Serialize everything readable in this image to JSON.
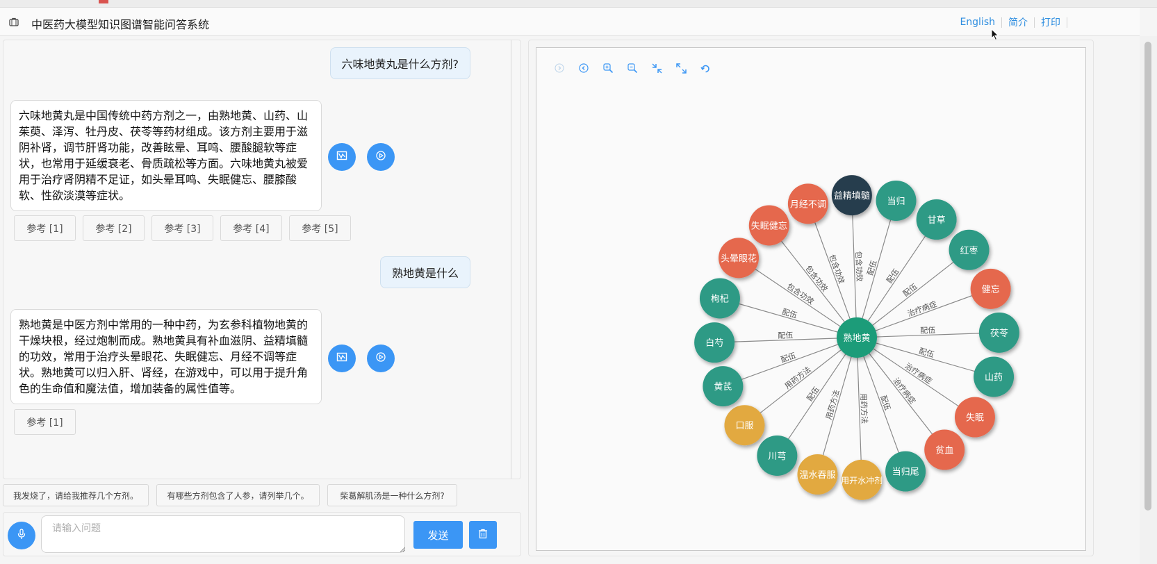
{
  "header": {
    "title": "中医药大模型知识图谱智能问答系统",
    "nav": [
      "English",
      "简介",
      "打印"
    ]
  },
  "chat": {
    "messages": [
      {
        "role": "user",
        "text": "六味地黄丸是什么方剂?"
      },
      {
        "role": "bot",
        "lines": [
          "六味地黄丸是中国传统中药方剂之一，由熟地黄、山药、山",
          "茱萸、泽泻、牡丹皮、茯苓等药材组成。该方剂主要用于滋",
          "阴补肾，调节肝肾功能，改善眩晕、耳鸣、腰酸腿软等症",
          "状，也常用于延缓衰老、骨质疏松等方面。六味地黄丸被爱",
          "用于治疗肾阴精不足证，如头晕耳鸣、失眠健忘、腰膝酸",
          "软、性欲淡漠等症状。"
        ],
        "refs": [
          "参考 [1]",
          "参考 [2]",
          "参考 [3]",
          "参考 [4]",
          "参考 [5]"
        ]
      },
      {
        "role": "user",
        "text": "熟地黄是什么"
      },
      {
        "role": "bot",
        "lines": [
          "熟地黄是中医方剂中常用的一种中药，为玄参科植物地黄的",
          "干燥块根，经过炮制而成。熟地黄具有补血滋阴、益精填髓",
          "的功效，常用于治疗头晕眼花、失眠健忘、月经不调等症",
          "状。熟地黄可以归入肝、肾经，在游戏中，可以用于提升角",
          "色的生命值和魔法值，增加装备的属性值等。"
        ],
        "refs": [
          "参考 [1]"
        ]
      }
    ]
  },
  "suggestions": [
    "我发烧了，请给我推荐几个方剂。",
    "有哪些方剂包含了人参，请列举几个。",
    "柴葛解肌汤是一种什么方剂?"
  ],
  "input": {
    "placeholder": "请输入问题",
    "value": "",
    "send_label": "发送"
  },
  "icons": {
    "briefcase": "briefcase-icon",
    "map": "map-icon",
    "play": "play-circle-icon",
    "mic": "microphone-icon",
    "trash": "trash-icon"
  },
  "toolbar_icons": [
    "chevron-right-icon",
    "chevron-left-circle-icon",
    "zoom-in-icon",
    "zoom-out-icon",
    "fit-view-icon",
    "fullscreen-icon",
    "rotate-icon"
  ],
  "colors": {
    "accent": "#3b96f5",
    "link": "#2f8ee0",
    "node_teal": "#2e9a85",
    "node_center": "#1b9c79",
    "node_orange": "#e5684d",
    "node_gold": "#e2a93f",
    "node_dark": "#283e4d",
    "edge": "#8a8a8a"
  },
  "graph": {
    "center": "熟地黄",
    "nodes": [
      {
        "label": "益精填髓",
        "relation": "包含功效",
        "color": "dark"
      },
      {
        "label": "当归",
        "relation": "配伍",
        "color": "teal"
      },
      {
        "label": "甘草",
        "relation": "配伍",
        "color": "teal"
      },
      {
        "label": "红枣",
        "relation": "配伍",
        "color": "teal"
      },
      {
        "label": "健忘",
        "relation": "治疗病症",
        "color": "orange"
      },
      {
        "label": "茯苓",
        "relation": "配伍",
        "color": "teal"
      },
      {
        "label": "山药",
        "relation": "配伍",
        "color": "teal"
      },
      {
        "label": "失眠",
        "relation": "治疗病症",
        "color": "orange"
      },
      {
        "label": "贫血",
        "relation": "治疗病症",
        "color": "orange"
      },
      {
        "label": "当归尾",
        "relation": "配伍",
        "color": "teal"
      },
      {
        "label": "用开水冲剂",
        "relation": "用药方法",
        "color": "gold"
      },
      {
        "label": "温水吞服",
        "relation": "用药方法",
        "color": "gold"
      },
      {
        "label": "川芎",
        "relation": "配伍",
        "color": "teal"
      },
      {
        "label": "口服",
        "relation": "用药方法",
        "color": "gold"
      },
      {
        "label": "黄芪",
        "relation": "配伍",
        "color": "teal"
      },
      {
        "label": "白芍",
        "relation": "配伍",
        "color": "teal"
      },
      {
        "label": "枸杞",
        "relation": "配伍",
        "color": "teal"
      },
      {
        "label": "头晕眼花",
        "relation": "包含功效",
        "color": "orange"
      },
      {
        "label": "失眠健忘",
        "relation": "包含功效",
        "color": "orange"
      },
      {
        "label": "月经不调",
        "relation": "包含功效",
        "color": "orange"
      }
    ]
  }
}
